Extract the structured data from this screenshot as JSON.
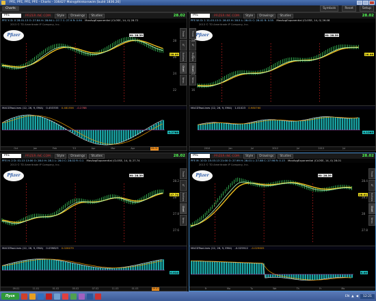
{
  "window": {
    "title": "PFE, PFE, PFE, PFE - Charts - 336427 Main@thinkorswim [build 1836.26]"
  },
  "menubar": {
    "tab_label": "Charts",
    "symbols_label": "Symbols",
    "reset_label": "Reset",
    "setup_label": "Setup"
  },
  "panes": [
    {
      "symbol": "PFE",
      "source": "PFIZER INC COM",
      "style_label": "Style",
      "drawings_label": "Drawings",
      "studies_label": "Studies",
      "last": "28.02",
      "quote": "PFE  Y:  D: 0  28.01.13  O: 27.84  H: 28.64  L: 27.7  C: 27.9  R: 0.94",
      "study": "MovAvgExponential (CLOSE, 14, 0)  28.72",
      "copyright": "2013 © TD Ameritrade IP Company, Inc.",
      "hi_label": "Hi: 28.39",
      "price_tag": "28.09",
      "price_ticks": [
        "28",
        "26",
        "24",
        "22"
      ],
      "macd_label": "MACDTwoLines (12, 26, 9, EMA)",
      "macd_v1": "0.453335",
      "macd_v2": "0.481556",
      "macd_v3": "-0.2788",
      "macd_tag": "0.2788",
      "dates": [
        "Oct",
        "Jan",
        "Feb",
        "'13",
        "Apr",
        "Mar",
        "Apr"
      ],
      "hl_date": "09.01",
      "side_tabs": [
        "Trade",
        "AT",
        "Buttons",
        "Chart",
        "News"
      ]
    },
    {
      "symbol": "PFE",
      "source": "PFIZER INC COM",
      "style_label": "Style",
      "drawings_label": "Drawings",
      "studies_label": "Studies",
      "last": "28.02",
      "quote": "PFE  W:  D: 1  11.03.13  O: 28.03  H: 28.5  L: 28.01  C: 28.02  R: 0.55",
      "study": "MovAvgExponential (CLOSE, 14, 0)  26.08",
      "copyright": "2013 © TD Ameritrade IP Company, Inc.",
      "hi_label": "Hi: 28.39",
      "price_tag": "26.08",
      "price_ticks": [
        "28",
        "24",
        "20",
        "16"
      ],
      "macd_label": "MACDTwoLines (12, 26, 9, EMA)",
      "macd_v1": "1.01023",
      "macd_v2": "0.980760",
      "macd_v3": "",
      "macd_tag": "0.1285",
      "dates": [
        "2010",
        "Jan",
        "Jul",
        "2012",
        "Jul",
        "2013",
        "Jul"
      ],
      "hl_date": "",
      "side_tabs": [
        "Trade",
        "AT",
        "Buttons",
        "Chart",
        "News"
      ]
    },
    {
      "symbol": "PFE",
      "source": "PFIZER INC COM",
      "style_label": "Style",
      "drawings_label": "Drawings",
      "studies_label": "Studies",
      "last": "28.02",
      "quote": "PFE  H: 2  D: 01.13 13:00  O: 28.0  H: 28.1  L: 28.0  C: 28.02  R: 0.1",
      "study": "MovAvgExponential (CLOSE, 14, 0)  27.74",
      "copyright": "2013 © TD Ameritrade IP Company, Inc.",
      "hi_label": "Hi: 28.39",
      "price_tag": "27.74",
      "price_ticks": [
        "28.2",
        "28",
        "27.8",
        "27.6"
      ],
      "macd_label": "MACDTwoLines (12, 26, 9, EMA)",
      "macd_v1": "0.039823",
      "macd_v2": "0.026079",
      "macd_v3": "",
      "macd_tag": "0.014",
      "dates": [
        "09.01",
        "11.01",
        "01.02",
        "05.02",
        "07.02",
        "11.03",
        "01.03"
      ],
      "hl_date": "09.01",
      "side_tabs": [
        "Trade",
        "AT",
        "Buttons",
        "Chart",
        "News"
      ]
    },
    {
      "symbol": "PFE",
      "source": "PFIZER INC COM",
      "style_label": "Style",
      "drawings_label": "Drawings",
      "studies_label": "Studies",
      "last": "28.02",
      "quote": "PFE  M: 10  D: 15.03.13 21:00  O: 27.99  H: 28.01  L: 27.88  C: 27.98  R: 0.13",
      "study": "MovAvgExponential (CLOSE, 14, 0)  28.01",
      "copyright": "2013 © TD Ameritrade IP Company, Inc.",
      "hi_label": "Hi: 28.39",
      "price_tag": "28.01",
      "price_ticks": [
        "28.4",
        "28.2",
        "28",
        "27.8"
      ],
      "macd_label": "MACDTwoLines (12, 26, 9, EMA)",
      "macd_v1": "-0.025912",
      "macd_v2": "-0.029605",
      "macd_v3": "",
      "macd_tag": "0.00",
      "dates": [
        "Fr",
        "Mo",
        "Tu",
        "We",
        "Th",
        "Fr",
        "Mo"
      ],
      "hl_date": "",
      "side_tabs": [
        "Trade",
        "AT",
        "Buttons",
        "Chart",
        "News"
      ]
    }
  ],
  "logo_text": "Pfizer",
  "taskbar": {
    "start_label": "Пуск",
    "lang": "EN",
    "clock": "12:21"
  },
  "colors": {
    "ema": "#f0c020",
    "price": "#3cd060",
    "macd_hist": "#1aa8a8",
    "macd_line": "#d0d0d0",
    "signal_line": "#f0a000",
    "event_marker": "#d02020"
  }
}
